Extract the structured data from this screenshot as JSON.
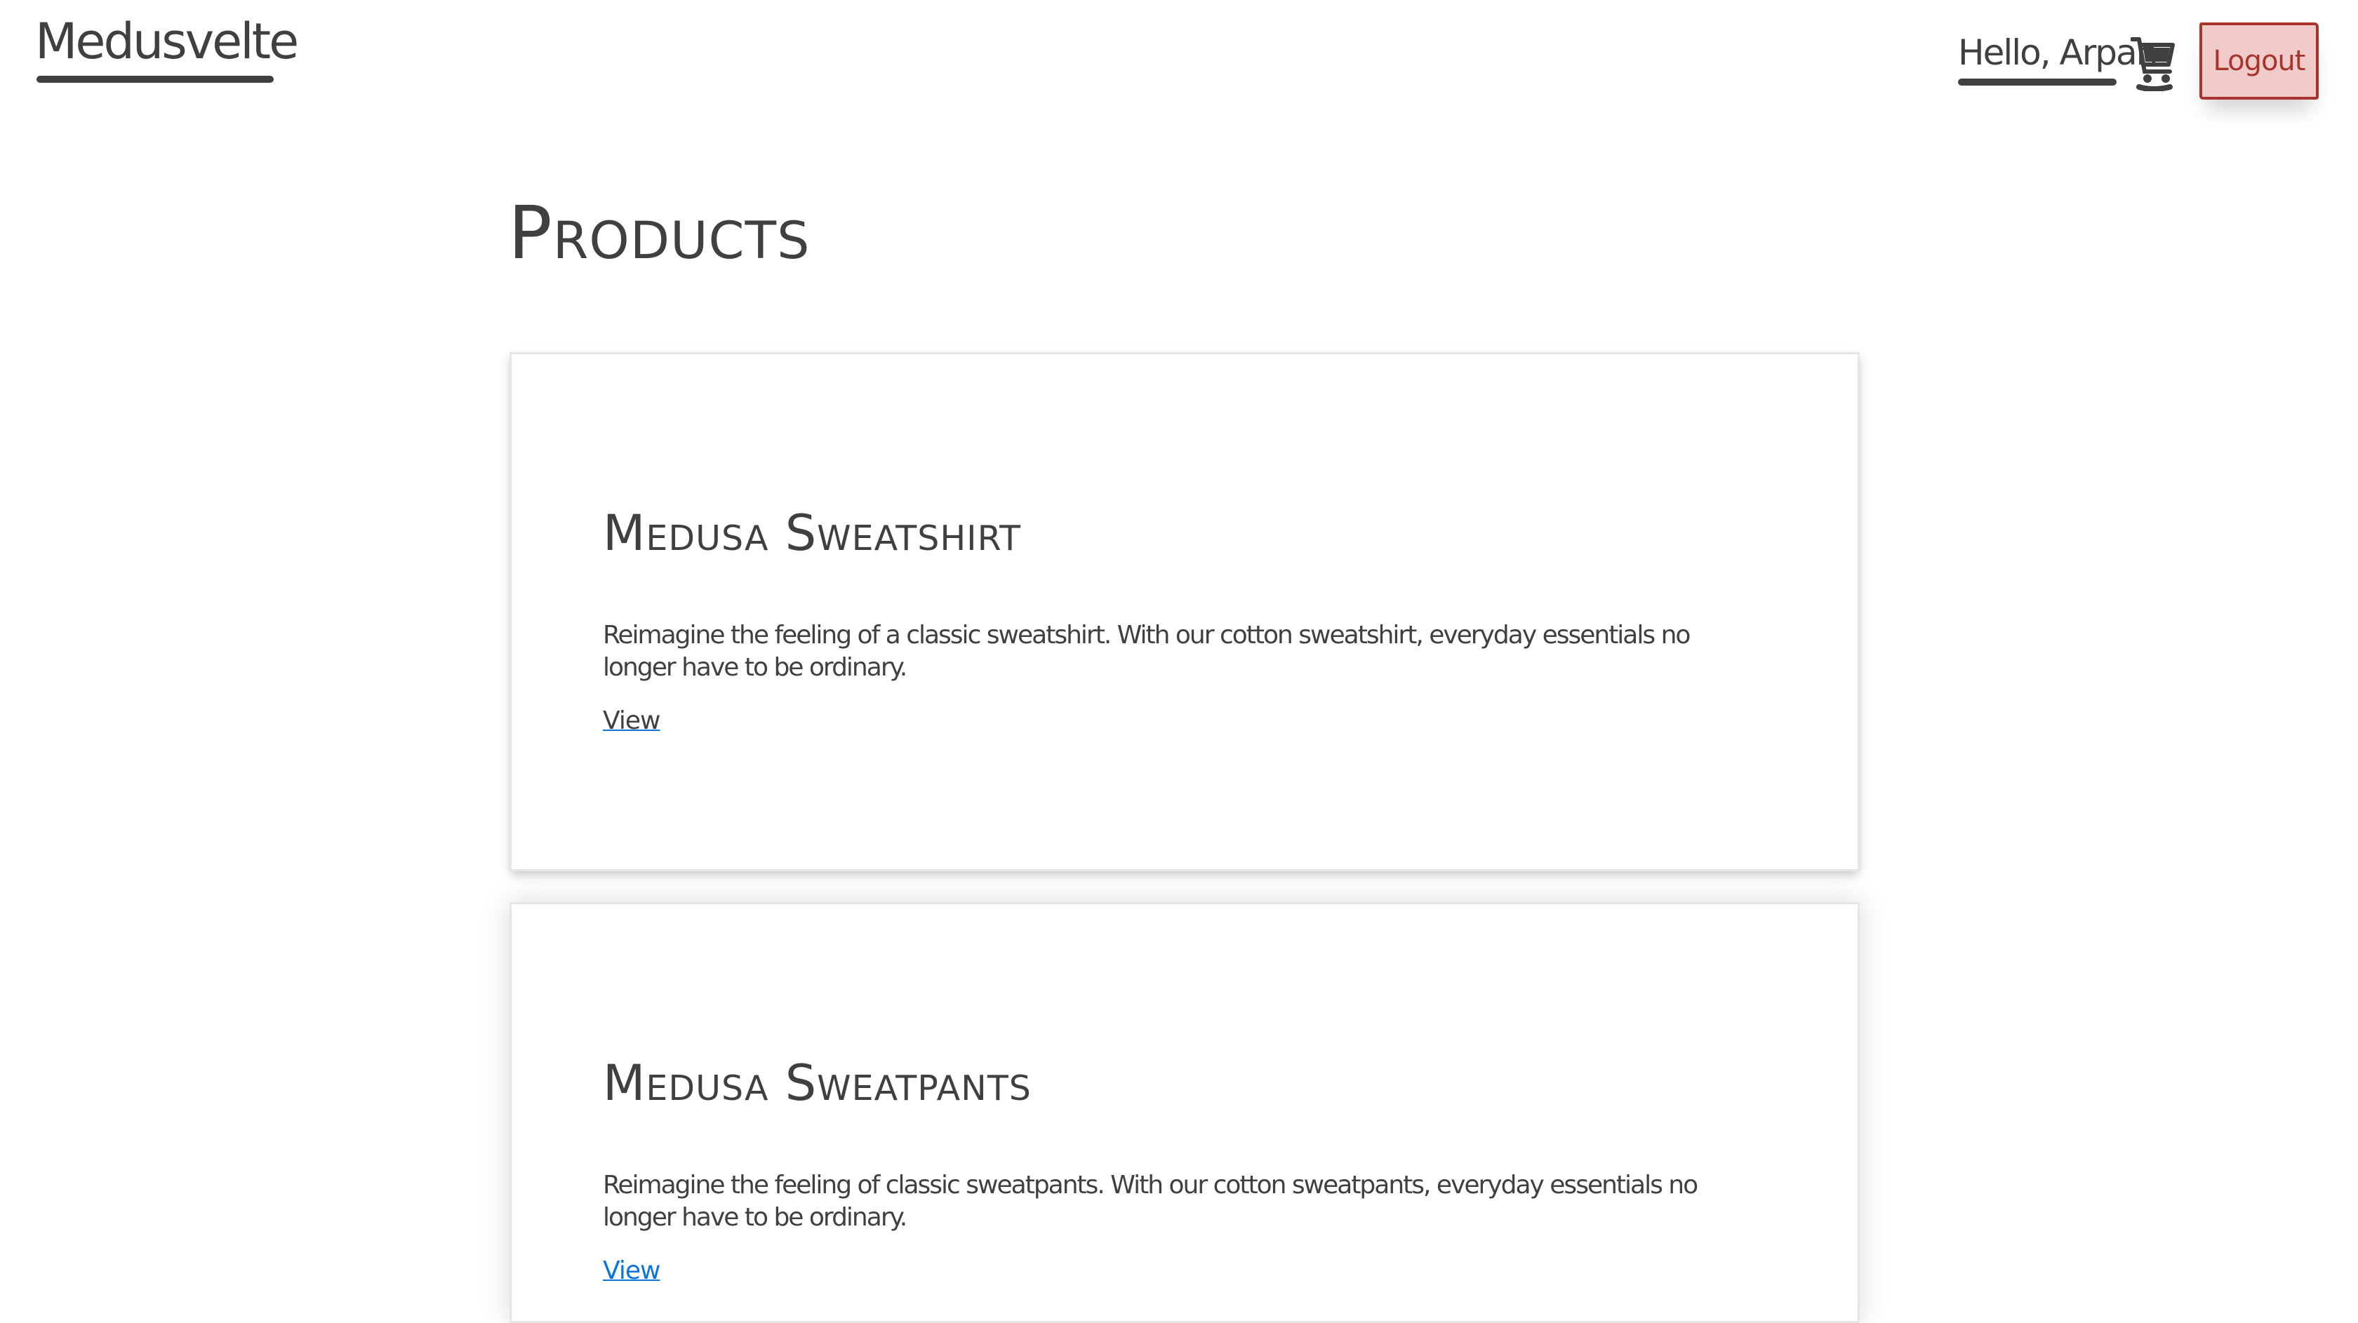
{
  "header": {
    "brand": "Medusvelte",
    "greeting": "Hello, Arpan",
    "cart_icon": "shopping-cart-icon",
    "logout_label": "Logout"
  },
  "main": {
    "title": "Products",
    "products": [
      {
        "name": "Medusa Sweatshirt",
        "description": "Reimagine the feeling of a classic sweatshirt. With our cotton sweatshirt, everyday essentials no longer have to be ordinary.",
        "link_label": "View"
      },
      {
        "name": "Medusa Sweatpants",
        "description": "Reimagine the feeling of classic sweatpants. With our cotton sweatpants, everyday essentials no longer have to be ordinary.",
        "link_label": "View"
      }
    ]
  },
  "colors": {
    "text": "#41403e",
    "danger_bg": "#f0cbc9",
    "danger_border": "#a7342d",
    "link_underline": "#0b74de"
  }
}
